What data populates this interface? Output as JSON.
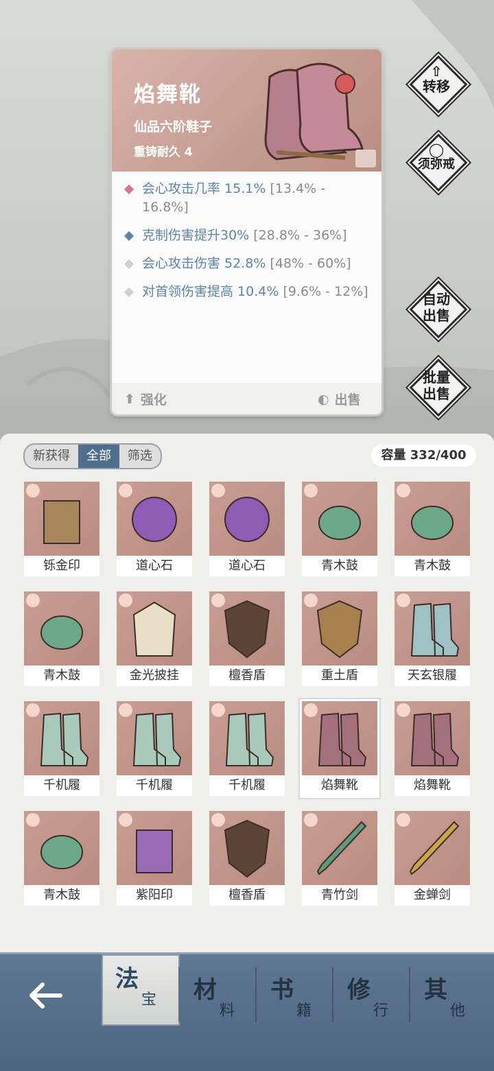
{
  "detail": {
    "name": "焰舞靴",
    "grade": "仙品六阶鞋子",
    "durability": "重铸耐久 4",
    "stats": [
      {
        "name": "会心攻击几率 15.1%",
        "range": " [13.4% - 16.8%]",
        "color": "#d6739a"
      },
      {
        "name": "克制伤害提升30%",
        "range": " [28.8% - 36%]",
        "color": "#5c86a8"
      },
      {
        "name": "会心攻击伤害 52.8%",
        "range": " [48% - 60%]",
        "color": "#c9c9c9"
      },
      {
        "name": "对首领伤害提高 10.4%",
        "range": " [9.6% - 12%]",
        "color": "#c9c9c9"
      }
    ],
    "upgrade_label": "强化",
    "sell_label": "出售"
  },
  "side_buttons": {
    "transfer": "转移",
    "sumeru_ring": "须弥戒",
    "auto_sell": [
      "自动",
      "出售"
    ],
    "bulk_sell": [
      "批量",
      "出售"
    ]
  },
  "inventory": {
    "tabs": [
      "新获得",
      "全部",
      "筛选"
    ],
    "active_tab": "全部",
    "capacity": "容量 332/400",
    "items": [
      {
        "name": "铄金印",
        "icon": "seal-icon",
        "tint": "#a8855a"
      },
      {
        "name": "道心石",
        "icon": "orb-icon",
        "tint": "#8e5bb5"
      },
      {
        "name": "道心石",
        "icon": "orb-icon",
        "tint": "#8e5bb5"
      },
      {
        "name": "青木鼓",
        "icon": "drum-icon",
        "tint": "#6ea88a"
      },
      {
        "name": "青木鼓",
        "icon": "drum-icon",
        "tint": "#6ea88a"
      },
      {
        "name": "青木鼓",
        "icon": "drum-icon",
        "tint": "#6ea88a"
      },
      {
        "name": "金光披挂",
        "icon": "cape-icon",
        "tint": "#e8dfc8"
      },
      {
        "name": "檀香盾",
        "icon": "shield-icon",
        "tint": "#5c4438"
      },
      {
        "name": "重土盾",
        "icon": "shield-icon",
        "tint": "#a7804e"
      },
      {
        "name": "天玄银履",
        "icon": "boots-icon",
        "tint": "#9ec1c4"
      },
      {
        "name": "千机履",
        "icon": "boots-icon",
        "tint": "#a9c9bb"
      },
      {
        "name": "千机履",
        "icon": "boots-icon",
        "tint": "#a9c9bb"
      },
      {
        "name": "千机履",
        "icon": "boots-icon",
        "tint": "#a9c9bb"
      },
      {
        "name": "焰舞靴",
        "icon": "boots-icon",
        "tint": "#a3707c"
      },
      {
        "name": "焰舞靴",
        "icon": "boots-icon",
        "tint": "#a3707c"
      },
      {
        "name": "青木鼓",
        "icon": "drum-icon",
        "tint": "#6ea88a"
      },
      {
        "name": "紫阳印",
        "icon": "seal-icon",
        "tint": "#9a6ab5"
      },
      {
        "name": "檀香盾",
        "icon": "shield-icon",
        "tint": "#5c4438"
      },
      {
        "name": "青竹剑",
        "icon": "sword-icon",
        "tint": "#5f9a7a"
      },
      {
        "name": "金蝉剑",
        "icon": "sword-icon",
        "tint": "#c9a64a"
      }
    ]
  },
  "nav": {
    "items": [
      {
        "big": "法",
        "small": "宝"
      },
      {
        "big": "材",
        "small": "料"
      },
      {
        "big": "书",
        "small": "籍"
      },
      {
        "big": "修",
        "small": "行"
      },
      {
        "big": "其",
        "small": "他"
      }
    ]
  }
}
